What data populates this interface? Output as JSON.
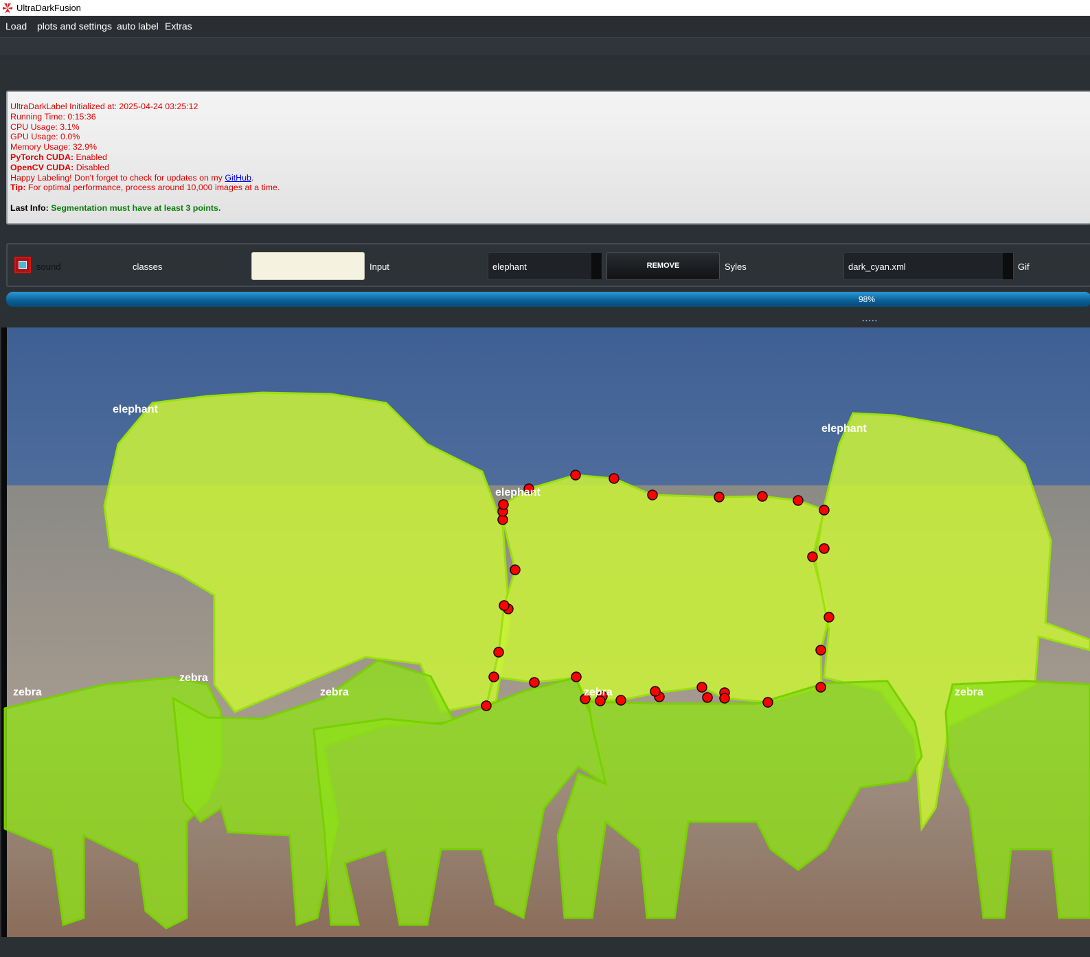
{
  "window": {
    "title": "UltraDarkFusion",
    "icon": "app-logo-icon"
  },
  "menu": [
    "Load",
    "plots and settings",
    "auto label",
    "Extras"
  ],
  "log": {
    "initialized": "UltraDarkLabel Initialized at: 2025-04-24 03:25:12",
    "running_time": "Running Time: 0:15:36",
    "cpu": "CPU Usage: 3.1%",
    "gpu": "GPU Usage: 0.0%",
    "memory": "Memory Usage: 32.9%",
    "pytorch_label": "PyTorch CUDA:",
    "pytorch_value": " Enabled",
    "opencv_label": "OpenCV CUDA:",
    "opencv_value": " Disabled",
    "happy_text": "Happy Labeling! Don't forget to check for updates on my ",
    "github_link": "GitHub",
    "happy_end": ".",
    "tip_label": "Tip:",
    "tip_text": " For optimal performance, process around 10,000 images at a time.",
    "last_info_label": "Last Info:",
    "last_info_text": " Segmentation must have at least 3 points."
  },
  "controls": {
    "sound_label": "sound",
    "sound_checked": true,
    "classes_label": "classes",
    "class_input_value": "",
    "input_label": "Input",
    "class_select_value": "elephant",
    "remove_button": "REMOVE",
    "styles_label": "Syles",
    "style_select_value": "dark_cyan.xml",
    "gif_label": "Gif"
  },
  "progress": {
    "value": 98,
    "text": "98%"
  },
  "status_dots": ".....",
  "canvas": {
    "mask_color": "#c8f03a",
    "point_color": "#ff0000",
    "labels": {
      "elephant_1": "elephant",
      "elephant_2": "elephant",
      "elephant_3": "elephant",
      "zebra_1": "zebra",
      "zebra_2": "zebra",
      "zebra_3": "zebra",
      "zebra_4": "zebra",
      "zebra_5": "zebra"
    }
  }
}
